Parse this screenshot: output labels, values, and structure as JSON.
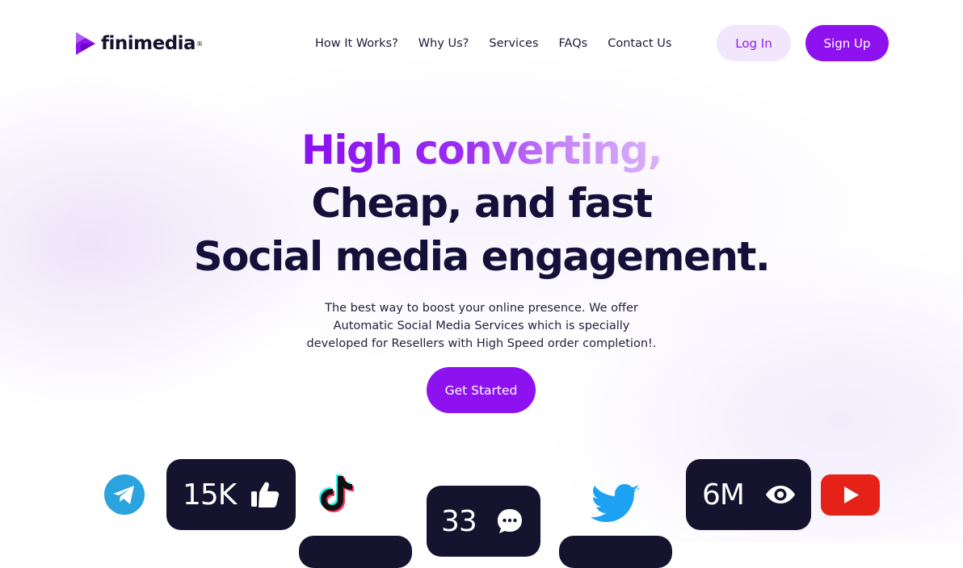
{
  "brand": {
    "name": "finimedia",
    "reg_mark": "®",
    "color": "#8e12f0"
  },
  "nav": {
    "items": [
      {
        "label": "How It Works?"
      },
      {
        "label": "Why Us?"
      },
      {
        "label": "Services"
      },
      {
        "label": "FAQs"
      },
      {
        "label": "Contact Us"
      }
    ]
  },
  "auth": {
    "login_label": "Log In",
    "signup_label": "Sign Up"
  },
  "hero": {
    "line1": "High converting,",
    "line2": "Cheap, and fast",
    "line3": "Social media engagement.",
    "subtitle_lines": [
      "The best way to boost your online presence. We offer",
      "Automatic Social Media Services which is specially",
      "developed for Resellers with High Speed order completion!."
    ],
    "cta_label": "Get Started"
  },
  "stats": {
    "likes": {
      "value": "15K",
      "icon": "thumbs-up-icon"
    },
    "comments": {
      "value": "33",
      "icon": "comment-icon"
    },
    "views": {
      "value": "6M",
      "icon": "eye-icon"
    }
  },
  "socials": [
    {
      "name": "telegram-icon",
      "color": "#2aa3de"
    },
    {
      "name": "tiktok-icon",
      "color": "#111111"
    },
    {
      "name": "twitter-icon",
      "color": "#1da1f2"
    },
    {
      "name": "youtube-icon",
      "color": "#e62117"
    }
  ]
}
